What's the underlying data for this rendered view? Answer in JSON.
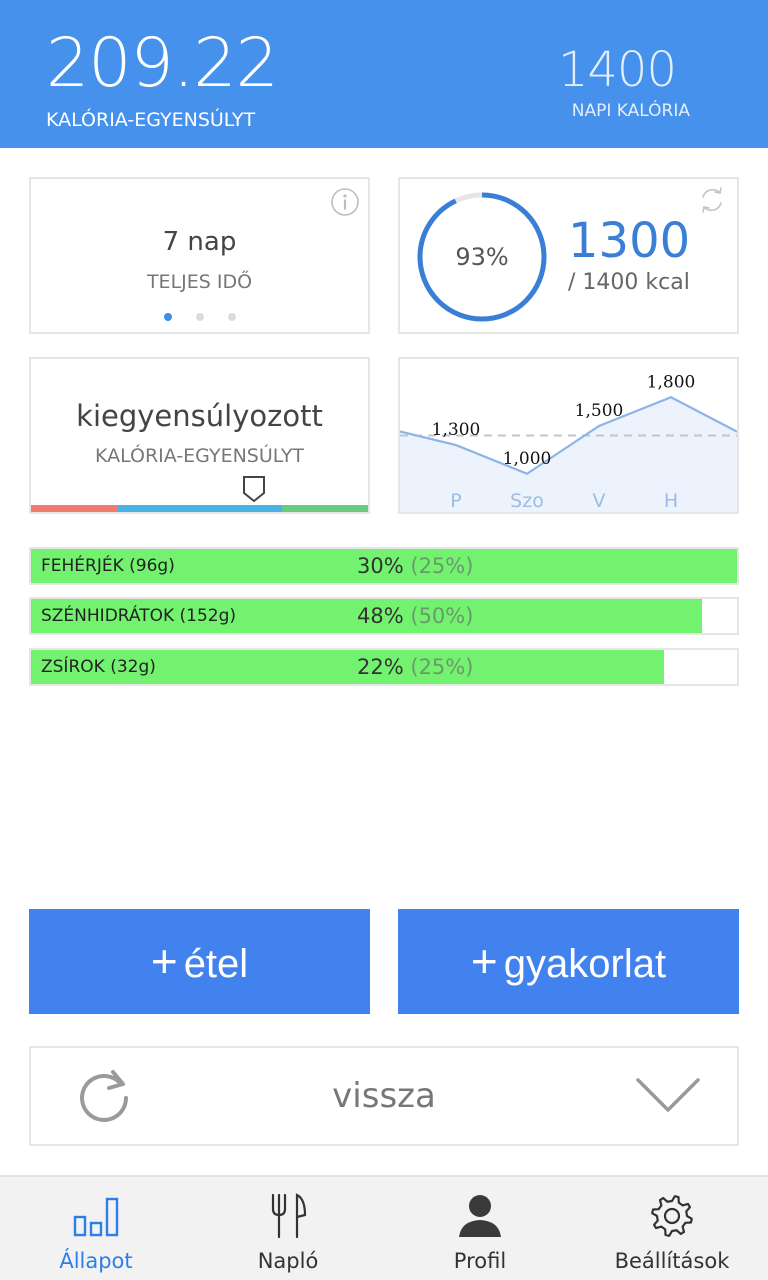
{
  "header": {
    "balance_value": "209.22",
    "balance_label": "KALÓRIA-EGYENSÚLYT",
    "daily_value": "1400",
    "daily_label": "NAPI KALÓRIA",
    "color": "#4591ec"
  },
  "days_card": {
    "value": "7 nap",
    "label": "TELJES IDŐ",
    "page_count": 3,
    "active_page": 0,
    "icon": "info-icon"
  },
  "progress_card": {
    "percent_text": "93%",
    "percent": 0.93,
    "eaten": "1300",
    "target": "/ 1400 kcal",
    "icon": "sync-icon"
  },
  "balance_card": {
    "state": "kiegyensúlyozott",
    "label": "KALÓRIA-EGYENSÚLYT"
  },
  "chart_data": {
    "type": "area",
    "categories": [
      "P",
      "Szo",
      "V",
      "H"
    ],
    "values": [
      1300,
      1000,
      1500,
      1800
    ],
    "value_labels": [
      "1,300",
      "1,000",
      "1,500",
      "1,800"
    ],
    "reference_line": 1400,
    "title": "",
    "xlabel": "",
    "ylabel": "",
    "line_color": "#8db4e8",
    "fill_color": "#edf3fc"
  },
  "macros": [
    {
      "name": "FEHÉRJÉK (96g)",
      "pct": "30%",
      "goal": "(25%)",
      "fraction": 1.0
    },
    {
      "name": "SZÉNHIDRÁTOK (152g)",
      "pct": "48%",
      "goal": "(50%)",
      "fraction": 0.95
    },
    {
      "name": "ZSÍROK (32g)",
      "pct": "22%",
      "goal": "(25%)",
      "fraction": 0.897
    }
  ],
  "actions": {
    "food_label": "étel",
    "exercise_label": "gyakorlat",
    "plus": "+",
    "color": "#4282ee"
  },
  "backbar": {
    "label": "vissza",
    "left_icon": "refresh-icon",
    "right_icon": "chevron-down-icon"
  },
  "nav": {
    "items": [
      {
        "label": "Állapot",
        "icon": "bar-chart-icon",
        "active": true
      },
      {
        "label": "Napló",
        "icon": "fork-knife-icon",
        "active": false
      },
      {
        "label": "Profil",
        "icon": "person-icon",
        "active": false
      },
      {
        "label": "Beállítások",
        "icon": "gear-icon",
        "active": false
      }
    ],
    "active_color": "#2d7fe8"
  }
}
